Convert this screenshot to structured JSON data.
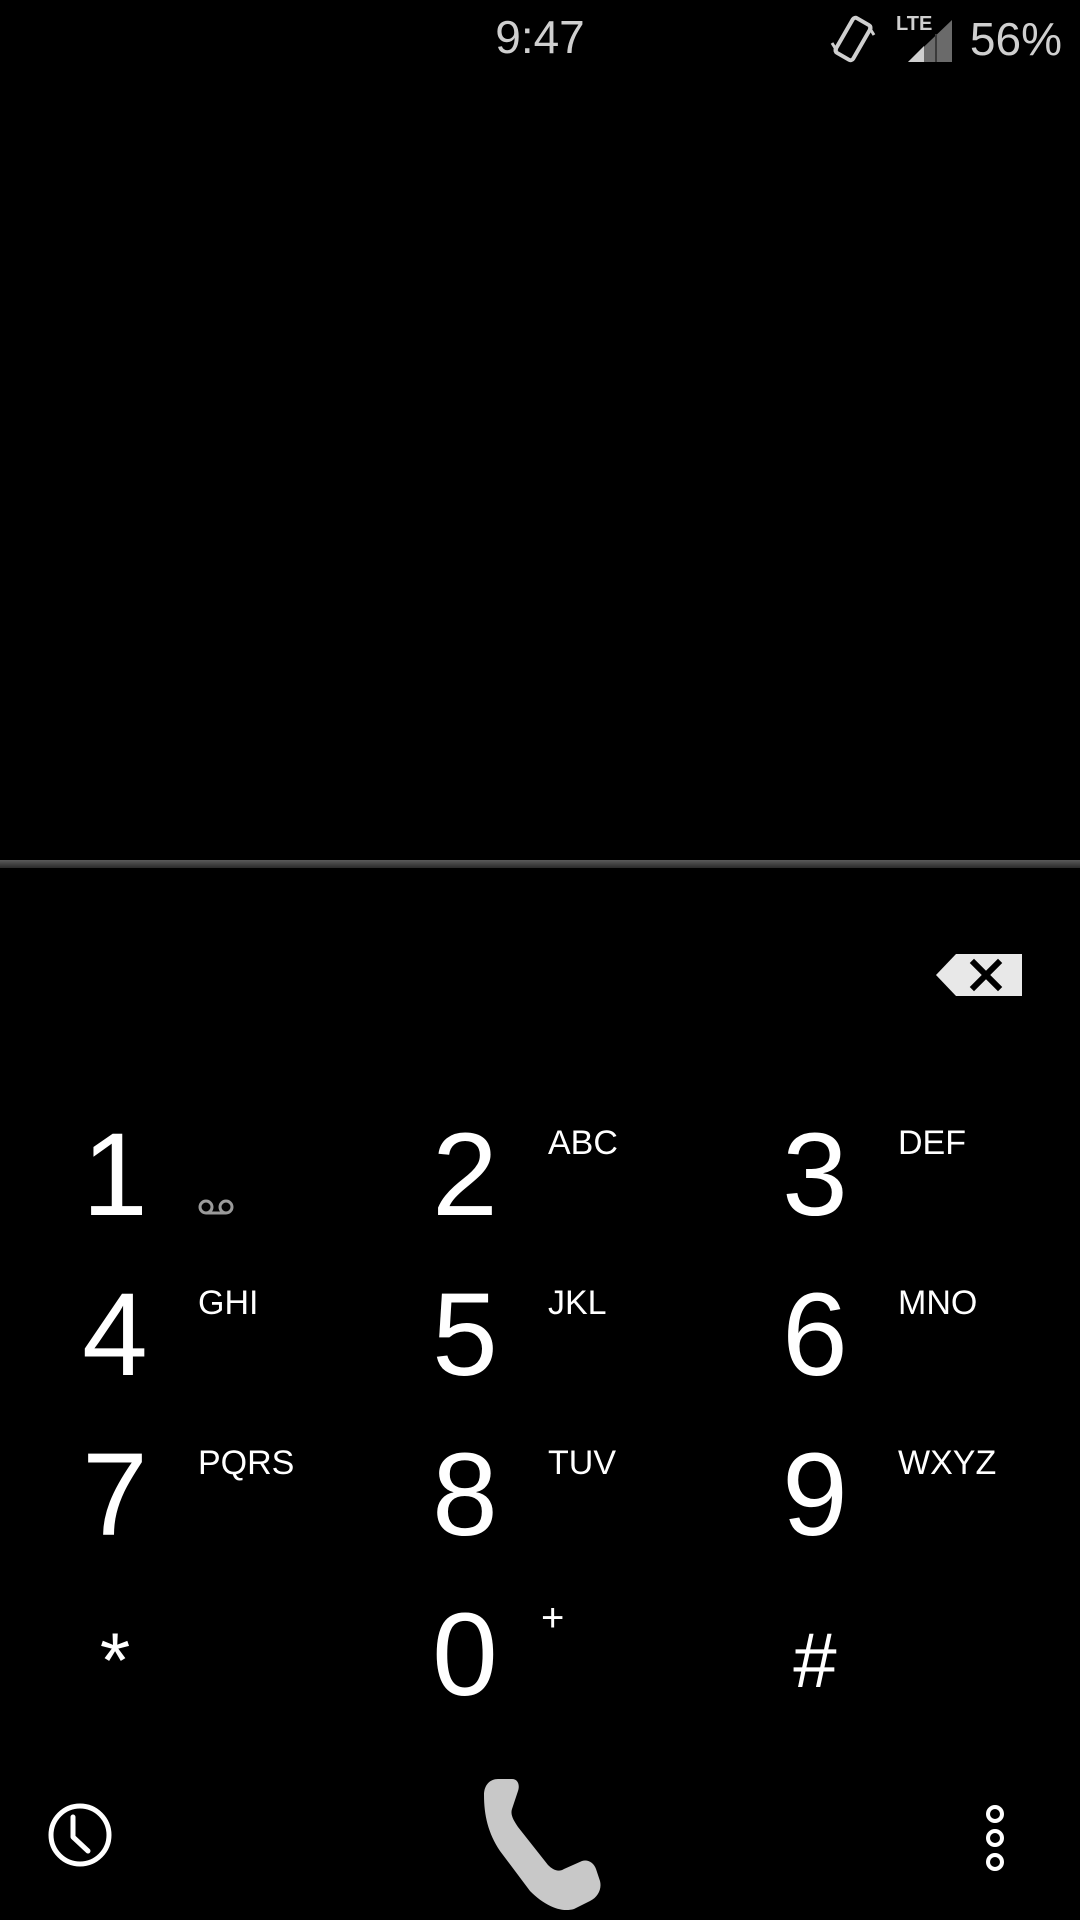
{
  "status_bar": {
    "time": "9:47",
    "network_label": "LTE",
    "battery": "56%",
    "icons": [
      "vibrate-icon",
      "lte-signal-icon"
    ]
  },
  "display": {
    "number": ""
  },
  "dialpad": {
    "keys": [
      {
        "digit": "1",
        "letters": "",
        "extra_icon": "voicemail-icon"
      },
      {
        "digit": "2",
        "letters": "ABC"
      },
      {
        "digit": "3",
        "letters": "DEF"
      },
      {
        "digit": "4",
        "letters": "GHI"
      },
      {
        "digit": "5",
        "letters": "JKL"
      },
      {
        "digit": "6",
        "letters": "MNO"
      },
      {
        "digit": "7",
        "letters": "PQRS"
      },
      {
        "digit": "8",
        "letters": "TUV"
      },
      {
        "digit": "9",
        "letters": "WXYZ"
      },
      {
        "digit": "*",
        "letters": ""
      },
      {
        "digit": "0",
        "letters": "+"
      },
      {
        "digit": "#",
        "letters": ""
      }
    ]
  },
  "actions": {
    "delete_icon": "backspace-icon",
    "history_icon": "clock-icon",
    "call_icon": "phone-icon",
    "overflow_icon": "more-vert-icon"
  },
  "colors": {
    "background": "#000000",
    "text": "#ffffff",
    "status_text": "#cfcfcf",
    "icon_gray": "#c8c8c8"
  }
}
